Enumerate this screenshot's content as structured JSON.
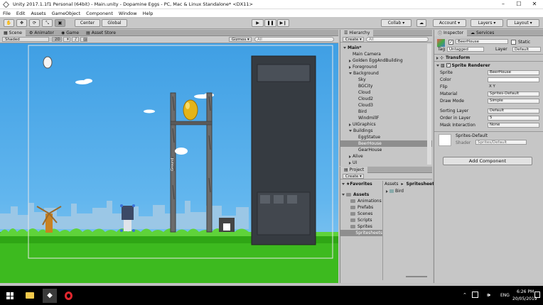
{
  "window": {
    "title": "Unity 2017.1.1f1 Personal (64bit) - Main.unity - Dopamine Eggs - PC, Mac & Linux Standalone* <DX11>"
  },
  "menu": [
    "File",
    "Edit",
    "Assets",
    "GameObject",
    "Component",
    "Window",
    "Help"
  ],
  "toolbar": {
    "center": "Center",
    "global": "Global",
    "collab": "Collab",
    "account": "Account",
    "layers": "Layers",
    "layout": "Layout"
  },
  "scene_panel": {
    "tabs": [
      "Scene",
      "Animator",
      "Game",
      "Asset Store"
    ],
    "shaded": "Shaded",
    "mode_2d": "2D",
    "gizmos": "Gizmos",
    "search_placeholder": "All",
    "tree_label": "Ground"
  },
  "hierarchy": {
    "tab": "Hierarchy",
    "create": "Create",
    "search_placeholder": "All",
    "items": [
      {
        "label": "Main*",
        "depth": 0,
        "expanded": true,
        "selected": false
      },
      {
        "label": "Main Camera",
        "depth": 1,
        "expanded": null,
        "selected": false
      },
      {
        "label": "Golden EggAndBuilding",
        "depth": 1,
        "expanded": false,
        "selected": false
      },
      {
        "label": "Foreground",
        "depth": 1,
        "expanded": false,
        "selected": false
      },
      {
        "label": "Background",
        "depth": 1,
        "expanded": true,
        "selected": false
      },
      {
        "label": "Sky",
        "depth": 2,
        "expanded": null,
        "selected": false
      },
      {
        "label": "BGCity",
        "depth": 2,
        "expanded": null,
        "selected": false
      },
      {
        "label": "Cloud",
        "depth": 2,
        "expanded": null,
        "selected": false
      },
      {
        "label": "Cloud2",
        "depth": 2,
        "expanded": null,
        "selected": false
      },
      {
        "label": "Cloud3",
        "depth": 2,
        "expanded": null,
        "selected": false
      },
      {
        "label": "Bird",
        "depth": 2,
        "expanded": null,
        "selected": false
      },
      {
        "label": "WindmillF",
        "depth": 2,
        "expanded": null,
        "selected": false
      },
      {
        "label": "UIGraphics",
        "depth": 1,
        "expanded": false,
        "selected": false
      },
      {
        "label": "Buildings",
        "depth": 1,
        "expanded": true,
        "selected": false
      },
      {
        "label": "EggStatue",
        "depth": 2,
        "expanded": null,
        "selected": false
      },
      {
        "label": "BeerHouse",
        "depth": 2,
        "expanded": null,
        "selected": true
      },
      {
        "label": "GearHouse",
        "depth": 2,
        "expanded": null,
        "selected": false
      },
      {
        "label": "Alive",
        "depth": 1,
        "expanded": false,
        "selected": false
      },
      {
        "label": "UI",
        "depth": 1,
        "expanded": false,
        "selected": false
      }
    ]
  },
  "project": {
    "tab": "Project",
    "create": "Create",
    "favorites": "Favorites",
    "breadcrumb": [
      "Assets",
      "Spritesheets"
    ],
    "assets_root": "Assets",
    "folders": [
      "Animations",
      "Prefabs",
      "Scenes",
      "Scripts",
      "Sprites",
      "Spritesheets"
    ],
    "selected_folder": "Spritesheets",
    "files": [
      "Bird"
    ]
  },
  "inspector": {
    "tabs": [
      "Inspector",
      "Services"
    ],
    "object_name": "BeerHouse",
    "static_label": "Static",
    "tag_label": "Tag",
    "tag_value": "Untagged",
    "layer_label": "Layer",
    "layer_value": "Default",
    "transform_title": "Transform",
    "sprite_renderer_title": "Sprite Renderer",
    "fields": [
      {
        "label": "Sprite",
        "value": "BeerHouse"
      },
      {
        "label": "Color",
        "value": ""
      },
      {
        "label": "Flip",
        "value": "X  Y"
      },
      {
        "label": "Material",
        "value": "Sprites-Default"
      },
      {
        "label": "Draw Mode",
        "value": "Simple"
      },
      {
        "label": "Sorting Layer",
        "value": "Default"
      },
      {
        "label": "Order in Layer",
        "value": "5"
      },
      {
        "label": "Mask Interaction",
        "value": "None"
      }
    ],
    "material_name": "Sprites-Default",
    "shader_label": "Shader",
    "shader_value": "Sprites/Default",
    "add_component": "Add Component"
  },
  "taskbar": {
    "lang": "ENG",
    "time": "6:26 PM",
    "date": "20/05/2019"
  },
  "colors": {
    "sky": "#3f9fe4",
    "grass": "#3dba1f",
    "selection": "#8e8e8e",
    "accent_blue": "#3a72d8"
  }
}
